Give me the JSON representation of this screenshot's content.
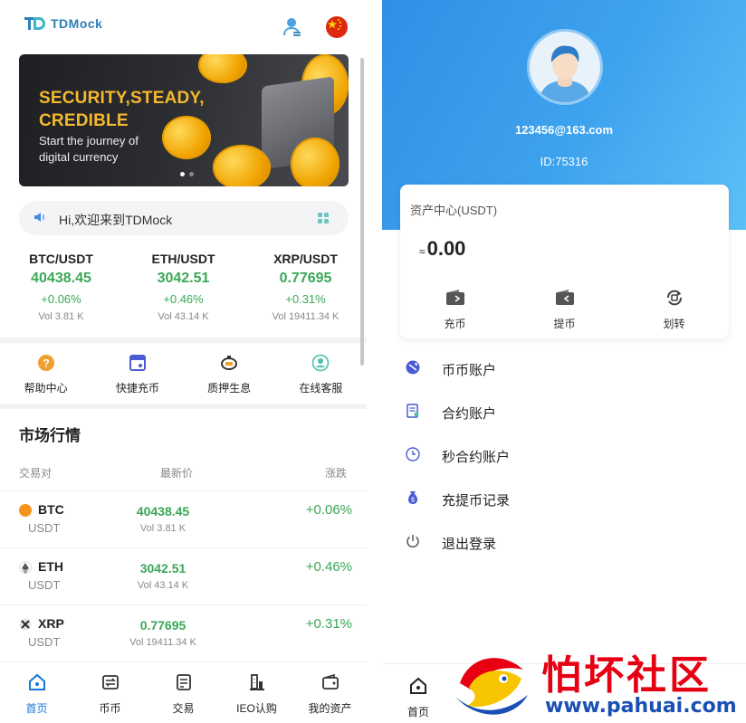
{
  "left": {
    "header": {
      "logo_text": "TDMock"
    },
    "banner": {
      "title": "SECURITY,STEADY,\nCREDIBLE",
      "subtitle": "Start the journey of\ndigital currency"
    },
    "notice": {
      "text": "Hi,欢迎来到TDMock"
    },
    "tickers": [
      {
        "pair": "BTC/USDT",
        "price": "40438.45",
        "change": "+0.06%",
        "volume": "Vol 3.81 K"
      },
      {
        "pair": "ETH/USDT",
        "price": "3042.51",
        "change": "+0.46%",
        "volume": "Vol 43.14 K"
      },
      {
        "pair": "XRP/USDT",
        "price": "0.77695",
        "change": "+0.31%",
        "volume": "Vol 19411.34 K"
      }
    ],
    "quick_menu": [
      {
        "label": "帮助中心",
        "icon": "help-icon"
      },
      {
        "label": "快捷充币",
        "icon": "quick-deposit-icon"
      },
      {
        "label": "质押生息",
        "icon": "staking-icon"
      },
      {
        "label": "在线客服",
        "icon": "customer-service-icon"
      }
    ],
    "market": {
      "title": "市场行情",
      "headers": {
        "pair": "交易对",
        "price": "最新价",
        "change": "涨跌"
      },
      "rows": [
        {
          "symbol": "BTC",
          "quote": "USDT",
          "price": "40438.45",
          "volume": "Vol 3.81 K",
          "change": "+0.06%",
          "icon": "btc-icon",
          "color": "#f7931a"
        },
        {
          "symbol": "ETH",
          "quote": "USDT",
          "price": "3042.51",
          "volume": "Vol 43.14 K",
          "change": "+0.46%",
          "icon": "eth-icon",
          "color": "#627eea"
        },
        {
          "symbol": "XRP",
          "quote": "USDT",
          "price": "0.77695",
          "volume": "Vol 19411.34 K",
          "change": "+0.31%",
          "icon": "xrp-icon",
          "color": "#23292f"
        }
      ]
    },
    "bottom_nav": [
      {
        "label": "首页",
        "icon": "home-icon",
        "active": true
      },
      {
        "label": "币币",
        "icon": "coin-trade-icon"
      },
      {
        "label": "交易",
        "icon": "trade-icon"
      },
      {
        "label": "IEO认购",
        "icon": "ieo-icon"
      },
      {
        "label": "我的资产",
        "icon": "wallet-icon"
      }
    ]
  },
  "right": {
    "profile": {
      "email": "123456@163.com",
      "id": "ID:75316"
    },
    "assets": {
      "title": "资产中心(USDT)",
      "approx": "≈",
      "amount": "0.00",
      "actions": [
        {
          "label": "充币",
          "icon": "deposit-icon"
        },
        {
          "label": "提币",
          "icon": "withdraw-icon"
        },
        {
          "label": "划转",
          "icon": "transfer-icon"
        }
      ]
    },
    "menu": [
      {
        "label": "币币账户",
        "icon": "coin-account-icon"
      },
      {
        "label": "合约账户",
        "icon": "contract-account-icon"
      },
      {
        "label": "秒合约账户",
        "icon": "clock-icon"
      },
      {
        "label": "充提币记录",
        "icon": "money-bag-icon"
      },
      {
        "label": "退出登录",
        "icon": "power-icon"
      }
    ],
    "bottom_nav": [
      {
        "label": "首页",
        "icon": "home-icon"
      }
    ]
  },
  "watermark": {
    "title": "怕坏社区",
    "url": "www.pahuai.com"
  },
  "colors": {
    "up_green": "#3aa757",
    "accent_blue": "#1677d8",
    "banner_gold": "#f5b82e",
    "header_blue": "#2f8fe6"
  }
}
